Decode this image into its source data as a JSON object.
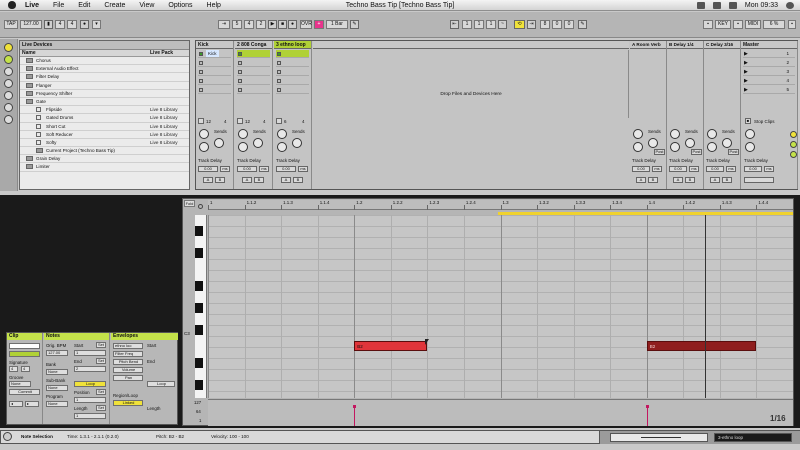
{
  "menubar": {
    "app": "Live",
    "items": [
      "File",
      "Edit",
      "Create",
      "View",
      "Options",
      "Help"
    ],
    "title": "Techno Bass Tip  [Techno Bass Tip]",
    "clock": "Mon 09:33"
  },
  "transport": {
    "tap": "TAP",
    "tempo": "127.00",
    "sig_num": "4",
    "sig_den": "4",
    "pos_a": "5",
    "pos_b": "4",
    "pos_c": "2",
    "ovr": "OVR",
    "quant": "1 Bar",
    "loop_a": "1",
    "loop_b": "1",
    "loop_c": "1",
    "loop_len_a": "8",
    "loop_len_b": "0",
    "loop_len_c": "0",
    "key": "KEY",
    "midi": "MIDI",
    "cpu": "6 %"
  },
  "browser": {
    "title": "Live Devices",
    "col_name": "Name",
    "col_loc": "Live Pack",
    "rows": [
      {
        "name": "Chorus",
        "loc": "",
        "indent": 1,
        "folder": true
      },
      {
        "name": "External Audio Effect",
        "loc": "",
        "indent": 1,
        "folder": true
      },
      {
        "name": "Filter Delay",
        "loc": "",
        "indent": 1,
        "folder": true
      },
      {
        "name": "Flanger",
        "loc": "",
        "indent": 1,
        "folder": true
      },
      {
        "name": "Frequency Shifter",
        "loc": "",
        "indent": 1,
        "folder": true
      },
      {
        "name": "Gate",
        "loc": "",
        "indent": 1,
        "folder": true
      },
      {
        "name": "Flipside",
        "loc": "Live 8 Library",
        "indent": 2,
        "folder": false
      },
      {
        "name": "Gated Drums",
        "loc": "Live 8 Library",
        "indent": 2,
        "folder": false
      },
      {
        "name": "Short Cut",
        "loc": "Live 8 Library",
        "indent": 2,
        "folder": false
      },
      {
        "name": "Soft Reducer",
        "loc": "Live 8 Library",
        "indent": 2,
        "folder": false
      },
      {
        "name": "Softy",
        "loc": "Live 8 Library",
        "indent": 2,
        "folder": false
      },
      {
        "name": "Current Project (Techno Bass Tip)",
        "loc": "",
        "indent": 2,
        "folder": true
      },
      {
        "name": "Grain Delay",
        "loc": "",
        "indent": 1,
        "folder": true
      },
      {
        "name": "Limiter",
        "loc": "",
        "indent": 1,
        "folder": true
      }
    ]
  },
  "session": {
    "tracks": [
      {
        "name": "Kick",
        "color": "#c8c8c8",
        "clip": "Kick"
      },
      {
        "name": "2 808 Conga",
        "color": "#c8c8c8",
        "clip": ""
      },
      {
        "name": "3 ethno loop",
        "color": "#b0d136",
        "clip": ""
      }
    ],
    "drop_text": "Drop Files and Devices Here",
    "returns": [
      {
        "name": "A Room Verb"
      },
      {
        "name": "B Delay 1/4"
      },
      {
        "name": "C Delay 3/16"
      }
    ],
    "master": "Master",
    "scenes": [
      "1",
      "2",
      "3",
      "4",
      "5"
    ],
    "stop_clips": "Stop Clips",
    "sends": "Sends",
    "post": "Post",
    "track_delay": "Track Delay",
    "delay_value": "0.00",
    "ms": "ms",
    "a": "A",
    "b": "B",
    "num_12": "12",
    "num_4": "4",
    "num_6": "6",
    "num_1": "1"
  },
  "clip_panel": {
    "clip_title": "Clip",
    "notes_title": "Notes",
    "env_title": "Envelopes",
    "orig_bpm_label": "Orig. BPM",
    "orig_bpm": "127.00",
    "start_label": "Start",
    "end_label": "End",
    "set": "Set",
    "signature_label": "Signature",
    "sig_a": "4",
    "sig_b": "4",
    "groove_label": "Groove",
    "groove_val": "None",
    "commit": "Commit",
    "bank_label": "Bank",
    "bank_val": "None",
    "sub_bank_label": "Sub-Bank",
    "sub_bank_val": "None",
    "program_label": "Program",
    "program_val": "None",
    "loop": "Loop",
    "position_label": "Position",
    "length_label": "Length",
    "env_device": "ethno loo",
    "env_param": "Filter Freq",
    "pitch_bend": "Pitch Bend",
    "volume": "Volume",
    "pan": "Pan",
    "region_loop": "Region/Loop",
    "linked": "Linked",
    "env_start": "Start",
    "env_end": "End",
    "env_loop": "Loop",
    "env_length": "Length",
    "start_v": "1",
    "end_v": "2",
    "pos_v": "1",
    "len_v": "1"
  },
  "editor": {
    "fold": "Fold",
    "ruler": [
      "1",
      "1.1.2",
      "1.1.3",
      "1.1.4",
      "1.2",
      "1.2.2",
      "1.2.3",
      "1.2.4",
      "1.3",
      "1.3.2",
      "1.3.3",
      "1.3.4",
      "1.4",
      "1.4.2",
      "1.4.3",
      "1.4.4"
    ],
    "c3_label": "C3",
    "notes": [
      {
        "label": "B2",
        "start": 4.0,
        "length": 2.0,
        "color": "#e0353a"
      },
      {
        "label": "B2",
        "start": 12.0,
        "length": 3.0,
        "color": "#8f1e1e"
      }
    ],
    "vel_max": "127",
    "vel_mid": "64",
    "vel_min": "1",
    "grid": "1/16"
  },
  "status": {
    "mode": "Note Selection",
    "time": "Time: 1.3.1 - 2.1.1 (0.2.0)",
    "pitch": "Pitch: B2 - B2",
    "velocity": "Velocity: 100 - 100",
    "track_name": "3-ethno loop"
  }
}
